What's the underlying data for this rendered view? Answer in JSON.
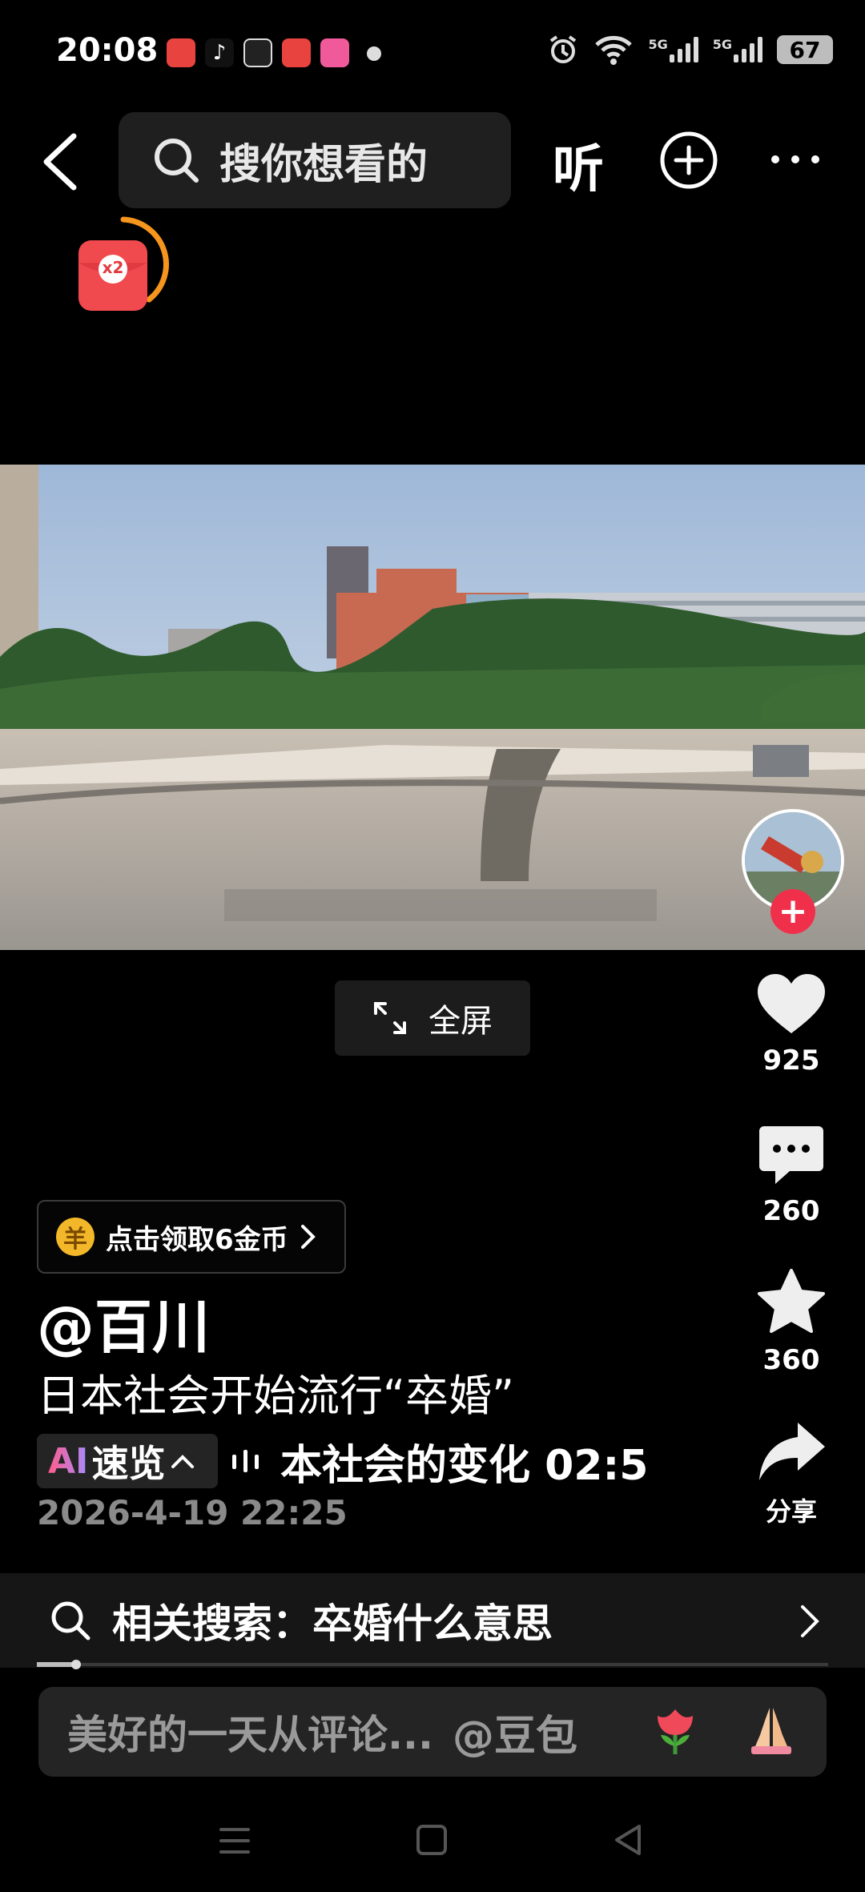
{
  "status_bar": {
    "time": "20:08",
    "network_1": "5G",
    "network_2": "5G",
    "battery": "67"
  },
  "top_nav": {
    "search_placeholder": "搜你想看的",
    "listen_label": "听"
  },
  "red_packet": {
    "multiplier": "x2"
  },
  "video_actions": {
    "fullscreen_label": "全屏",
    "likes": "925",
    "comments": "260",
    "favorites": "360",
    "share_label": "分享"
  },
  "coin_reward": {
    "icon_text": "羊",
    "label": "点击领取6金币"
  },
  "post": {
    "author": "@百川",
    "caption": "日本社会开始流行“卒婚”",
    "ai_tag": "AI",
    "ai_label": "速览",
    "ai_summary": "本社会的变化   02:5",
    "timestamp": "2026-4-19 22:25"
  },
  "related_search": {
    "text": "相关搜索：卒婚什么意思",
    "progress_percent": 5
  },
  "comment_bar": {
    "placeholder": "美好的一天从评论...",
    "mention": "@豆包"
  },
  "colors": {
    "accent_red": "#f0304a",
    "coin_gold": "#f3b82a",
    "background": "#000000"
  }
}
